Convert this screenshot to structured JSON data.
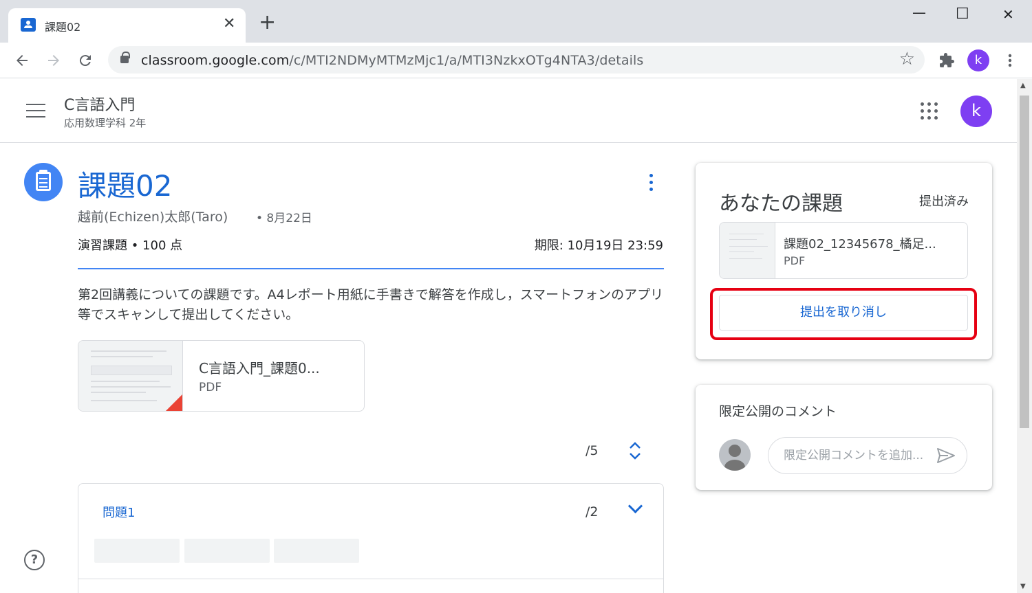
{
  "browser": {
    "tab_title": "課題02",
    "tab_close": "✕",
    "new_tab": "+",
    "minimize": "—",
    "maximize": "☐",
    "close": "✕",
    "url_domain": "classroom.google.com",
    "url_path": "/c/MTI2NDMyMTMzMjc1/a/MTI3NzkxOTg4NTA3/details",
    "profile_initial": "k"
  },
  "header": {
    "class_name": "C言語入門",
    "section": "応用数理学科 2年",
    "avatar_initial": "k"
  },
  "assignment": {
    "title": "課題02",
    "author": "越前(Echizen)太郎(Taro)",
    "date": "• 8月22日",
    "type_points": "演習課題 • 100 点",
    "due": "期限: 10月19日 23:59",
    "description": "第2回講義についての課題です。A4レポート用紙に手書きで解答を作成し，スマートフォンのアプリ等でスキャンして提出してください。",
    "attachment": {
      "name": "C言語入門_課題0...",
      "type": "PDF"
    },
    "total_points": "/5"
  },
  "question": {
    "title": "問題1",
    "points": "/2"
  },
  "your_work": {
    "title": "あなたの課題",
    "status": "提出済み",
    "file": {
      "name": "課題02_12345678_橘足...",
      "type": "PDF"
    },
    "unsubmit_label": "提出を取り消し"
  },
  "private_comments": {
    "title": "限定公開のコメント",
    "placeholder": "限定公開コメントを追加..."
  },
  "colors": {
    "accent": "#1967d2",
    "avatar": "#7e3ff2",
    "highlight": "#e60012"
  }
}
